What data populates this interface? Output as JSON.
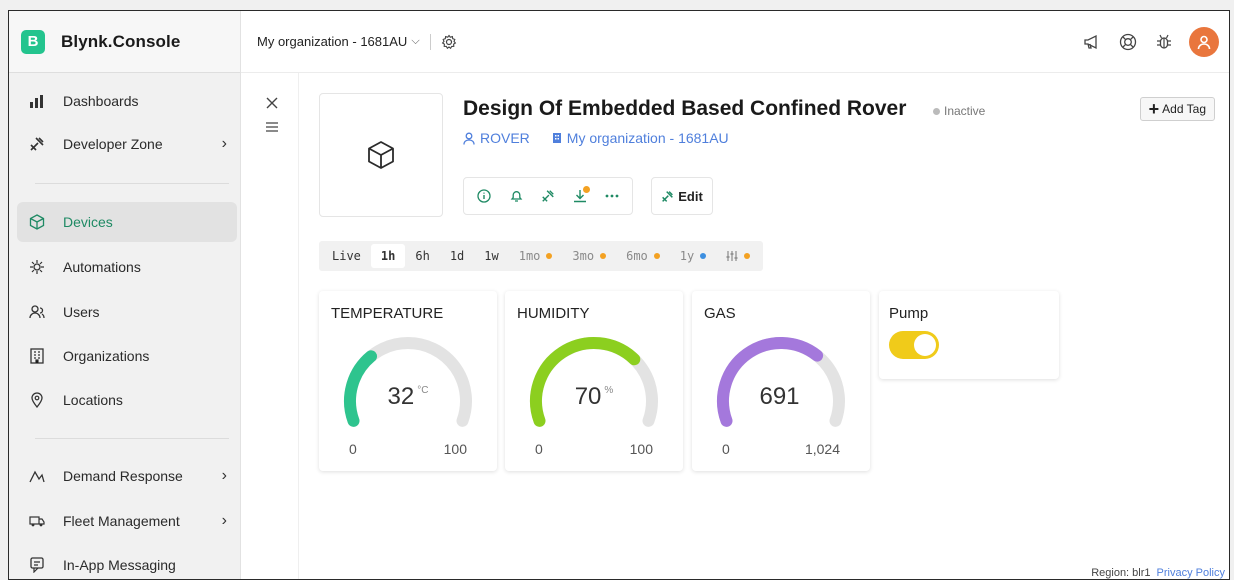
{
  "app": {
    "logo_letter": "B",
    "name": "Blynk.Console"
  },
  "sidebar": {
    "items": [
      {
        "label": "Dashboards",
        "icon": "dashboard-icon"
      },
      {
        "label": "Developer Zone",
        "icon": "tools-icon",
        "chevron": "›"
      },
      {
        "label": "Devices",
        "icon": "cube-icon",
        "active": true
      },
      {
        "label": "Automations",
        "icon": "automation-icon"
      },
      {
        "label": "Users",
        "icon": "users-icon"
      },
      {
        "label": "Organizations",
        "icon": "building-icon"
      },
      {
        "label": "Locations",
        "icon": "location-pin-icon"
      },
      {
        "label": "Demand Response",
        "icon": "demand-icon",
        "chevron": "›"
      },
      {
        "label": "Fleet Management",
        "icon": "truck-icon",
        "chevron": "›"
      },
      {
        "label": "In-App Messaging",
        "icon": "message-icon"
      }
    ]
  },
  "topbar": {
    "org": "My organization - 1681AU",
    "org_caret": "⌵"
  },
  "device": {
    "title": "Design Of Embedded Based Confined Rover",
    "status": "Inactive",
    "template": "ROVER",
    "organization": "My organization - 1681AU",
    "edit_label": "Edit",
    "add_tag_label": "Add Tag",
    "add_tag_plus": "+"
  },
  "time_ranges": [
    {
      "label": "Live"
    },
    {
      "label": "1h",
      "active": true
    },
    {
      "label": "6h"
    },
    {
      "label": "1d"
    },
    {
      "label": "1w"
    },
    {
      "label": "1mo",
      "dot": "#f3a122",
      "dim": true
    },
    {
      "label": "3mo",
      "dot": "#f3a122",
      "dim": true
    },
    {
      "label": "6mo",
      "dot": "#f3a122",
      "dim": true
    },
    {
      "label": "1y",
      "dot": "#3d8fe0",
      "dim": true
    },
    {
      "label": "custom",
      "dot": "#f3a122",
      "dim": true
    }
  ],
  "widgets": [
    {
      "title": "TEMPERATURE",
      "value": "32",
      "unit": "°C",
      "min": "0",
      "max": "100",
      "fraction": 0.32,
      "color": "#2ec48e"
    },
    {
      "title": "HUMIDITY",
      "value": "70",
      "unit": "%",
      "min": "0",
      "max": "100",
      "fraction": 0.7,
      "color": "#8ccf1f"
    },
    {
      "title": "GAS",
      "value": "691",
      "unit": "",
      "min": "0",
      "max": "1,024",
      "fraction": 0.675,
      "color": "#a478dc"
    }
  ],
  "pump": {
    "title": "Pump",
    "on": true
  },
  "footer": {
    "region": "Region: blr1",
    "privacy": "Privacy Policy"
  },
  "colors": {
    "accent": "#23c48e",
    "link": "#4f7fdc",
    "toggle": "#f0cb1a",
    "avatar": "#e9763d"
  }
}
